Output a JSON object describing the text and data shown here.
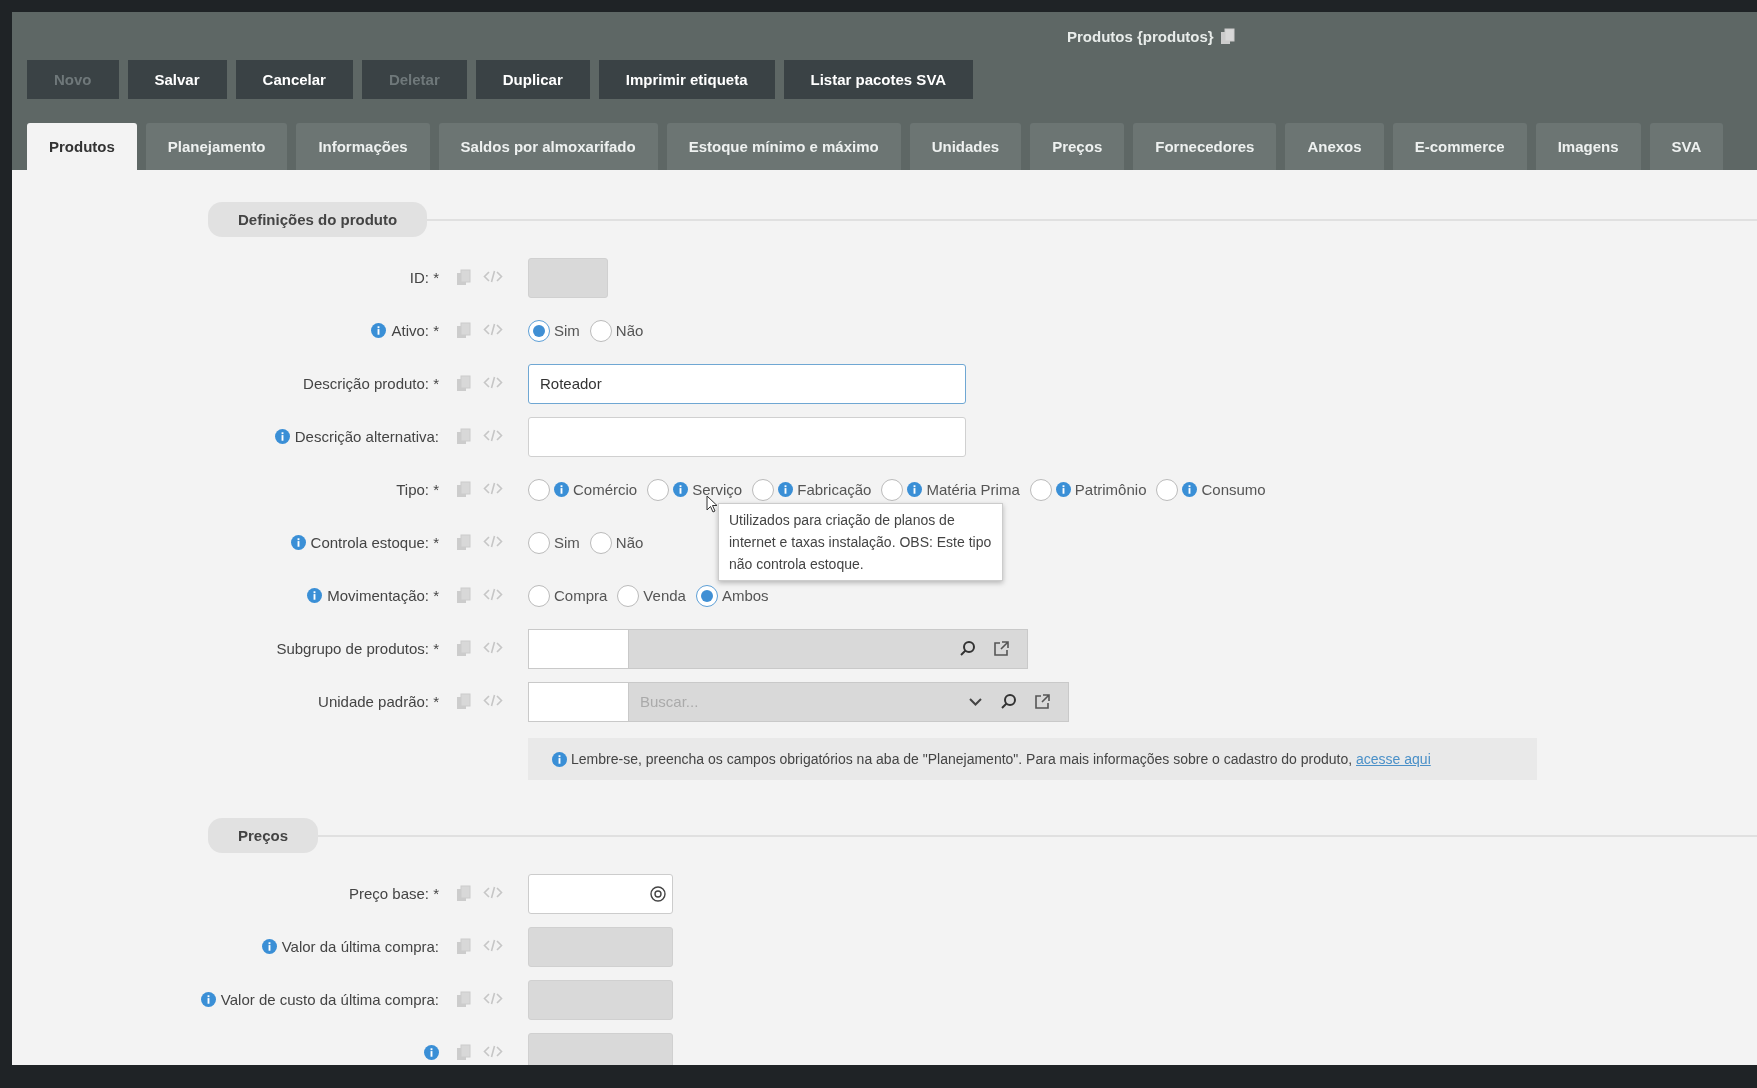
{
  "window": {
    "title": "Produtos {produtos}"
  },
  "toolbar": [
    {
      "label": "Novo",
      "disabled": true
    },
    {
      "label": "Salvar",
      "disabled": false
    },
    {
      "label": "Cancelar",
      "disabled": false
    },
    {
      "label": "Deletar",
      "disabled": true
    },
    {
      "label": "Duplicar",
      "disabled": false
    },
    {
      "label": "Imprimir etiqueta",
      "disabled": false
    },
    {
      "label": "Listar pacotes SVA",
      "disabled": false
    }
  ],
  "tabs": [
    {
      "label": "Produtos",
      "selected": true
    },
    {
      "label": "Planejamento",
      "selected": false
    },
    {
      "label": "Informações",
      "selected": false
    },
    {
      "label": "Saldos por almoxarifado",
      "selected": false
    },
    {
      "label": "Estoque mínimo e máximo",
      "selected": false
    },
    {
      "label": "Unidades",
      "selected": false
    },
    {
      "label": "Preços",
      "selected": false
    },
    {
      "label": "Fornecedores",
      "selected": false
    },
    {
      "label": "Anexos",
      "selected": false
    },
    {
      "label": "E-commerce",
      "selected": false
    },
    {
      "label": "Imagens",
      "selected": false
    },
    {
      "label": "SVA",
      "selected": false
    }
  ],
  "sections": [
    {
      "title": "Definições do produto",
      "fields": [
        {
          "kind": "short",
          "label": "ID: *",
          "info": false,
          "disabled": true,
          "focused": false
        },
        {
          "kind": "radio",
          "label": "Ativo: *",
          "info": true,
          "options": [
            {
              "label": "Sim",
              "selected": true,
              "info": false
            },
            {
              "label": "Não",
              "selected": false,
              "info": false
            }
          ]
        },
        {
          "kind": "long",
          "label": "Descrição produto: *",
          "info": false,
          "disabled": false,
          "focused": true,
          "value": "Roteador"
        },
        {
          "kind": "long",
          "label": "Descrição alternativa:",
          "info": true,
          "disabled": false,
          "focused": false
        },
        {
          "kind": "radio",
          "label": "Tipo: *",
          "info": false,
          "options": [
            {
              "label": "Comércio",
              "selected": false,
              "info": true
            },
            {
              "label": "Serviço",
              "selected": false,
              "info": true
            },
            {
              "label": "Fabricação",
              "selected": false,
              "info": true
            },
            {
              "label": "Matéria Prima",
              "selected": false,
              "info": true
            },
            {
              "label": "Patrimônio",
              "selected": false,
              "info": true
            },
            {
              "label": "Consumo",
              "selected": false,
              "info": true
            }
          ]
        },
        {
          "kind": "radio",
          "label": "Controla estoque: *",
          "info": true,
          "options": [
            {
              "label": "Sim",
              "selected": false,
              "info": false
            },
            {
              "label": "Não",
              "selected": false,
              "info": false
            }
          ]
        },
        {
          "kind": "radio",
          "label": "Movimentação: *",
          "info": true,
          "options": [
            {
              "label": "Compra",
              "selected": false,
              "info": false
            },
            {
              "label": "Venda",
              "selected": false,
              "info": false
            },
            {
              "label": "Ambos",
              "selected": true,
              "info": false
            }
          ]
        },
        {
          "kind": "lookup",
          "label": "Subgrupo de produtos: *",
          "info": false,
          "dropdown": false
        },
        {
          "kind": "lookup",
          "label": "Unidade padrão: *",
          "info": false,
          "dropdown": true,
          "placeholder": "Buscar..."
        }
      ],
      "note": {
        "text": "Lembre-se, preencha os campos obrigatórios na aba de \"Planejamento\". Para mais informações sobre o cadastro do produto,",
        "link": "acesse aqui"
      }
    },
    {
      "title": "Preços",
      "fields": [
        {
          "kind": "price",
          "label": "Preço base: *",
          "info": false
        },
        {
          "kind": "amount",
          "label": "Valor da última compra:",
          "info": true,
          "disabled": true,
          "focused": false
        },
        {
          "kind": "amount",
          "label": "Valor de custo da última compra:",
          "info": true,
          "disabled": true,
          "focused": false
        },
        {
          "kind": "amount",
          "info": true,
          "disabled": true,
          "focused": false
        }
      ]
    }
  ],
  "tooltip": {
    "text": "Utilizados para criação de planos de internet e taxas instalação. OBS: Este tipo não controla estoque."
  }
}
